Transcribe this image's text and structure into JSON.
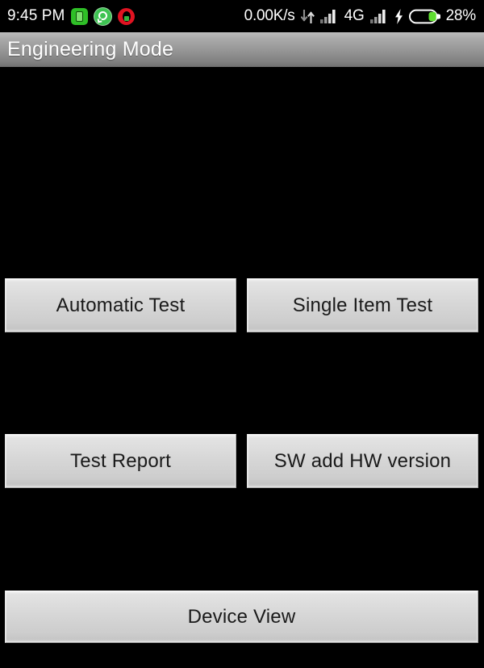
{
  "status_bar": {
    "clock": "9:45 PM",
    "network_speed": "0.00K/s",
    "network_type": "4G",
    "battery_percent": "28%",
    "notification_icons": [
      {
        "name": "battery-saver-notification-icon",
        "label": "battery-app"
      },
      {
        "name": "whatsapp-notification-icon",
        "label": "whatsapp"
      },
      {
        "name": "opera-notification-icon",
        "label": "opera"
      }
    ],
    "icons": {
      "data_transfer": "data-transfer-arrows-icon",
      "signal_1": "signal-bars-icon",
      "signal_2": "signal-bars-icon",
      "charging": "charging-bolt-icon",
      "battery": "battery-icon"
    },
    "colors": {
      "battery_fill": "#5fdd30",
      "text": "#ffffff",
      "background": "#000000"
    }
  },
  "title_bar": {
    "title": "Engineering Mode",
    "colors": {
      "gradient_top": "#bcbcbc",
      "gradient_bottom": "#6f6f6f",
      "text": "#ffffff"
    }
  },
  "main": {
    "background_color": "#000000",
    "buttons": [
      {
        "id": "automatic-test",
        "label": "Automatic Test"
      },
      {
        "id": "single-item-test",
        "label": "Single Item Test"
      },
      {
        "id": "test-report",
        "label": "Test Report"
      },
      {
        "id": "sw-add-hw-version",
        "label": "SW add HW version"
      },
      {
        "id": "device-view",
        "label": "Device View"
      }
    ],
    "button_colors": {
      "face_top": "#f2f2f2",
      "face_bottom": "#c6c6c6",
      "border": "#a6a6a6",
      "text": "#1a1a1a"
    }
  }
}
